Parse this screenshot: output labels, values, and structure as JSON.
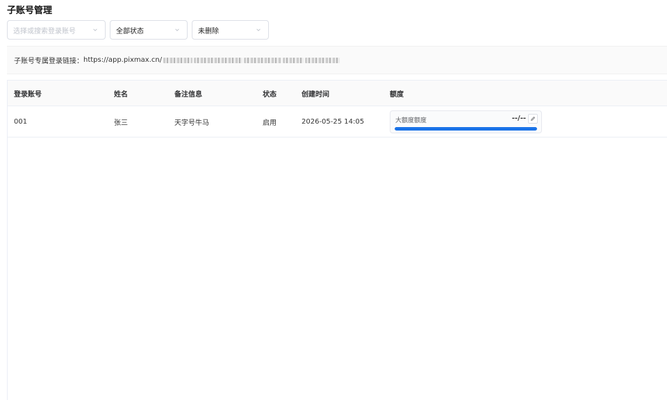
{
  "page": {
    "title": "子账号管理"
  },
  "filters": {
    "search_placeholder": "选择或搜索登录账号",
    "status_value": "全部状态",
    "deleted_value": "未删除"
  },
  "link": {
    "label": "子账号专属登录链接：",
    "url_prefix": "https://app.pixmax.cn/"
  },
  "table": {
    "headers": [
      "登录账号",
      "姓名",
      "备注信息",
      "状态",
      "创建时间",
      "额度"
    ],
    "rows": [
      {
        "account": "001",
        "name": "张三",
        "remark": "天字号牛马",
        "status": "启用",
        "created": "2026-05-25 14:05",
        "quota_label": "大额度额度",
        "quota_value": "--/--",
        "quota_fill": 1.0
      }
    ]
  },
  "colors": {
    "accent": "#1a73e8"
  },
  "icons": {
    "select_arrow": "chevron-down-icon",
    "edit": "pencil-icon"
  }
}
